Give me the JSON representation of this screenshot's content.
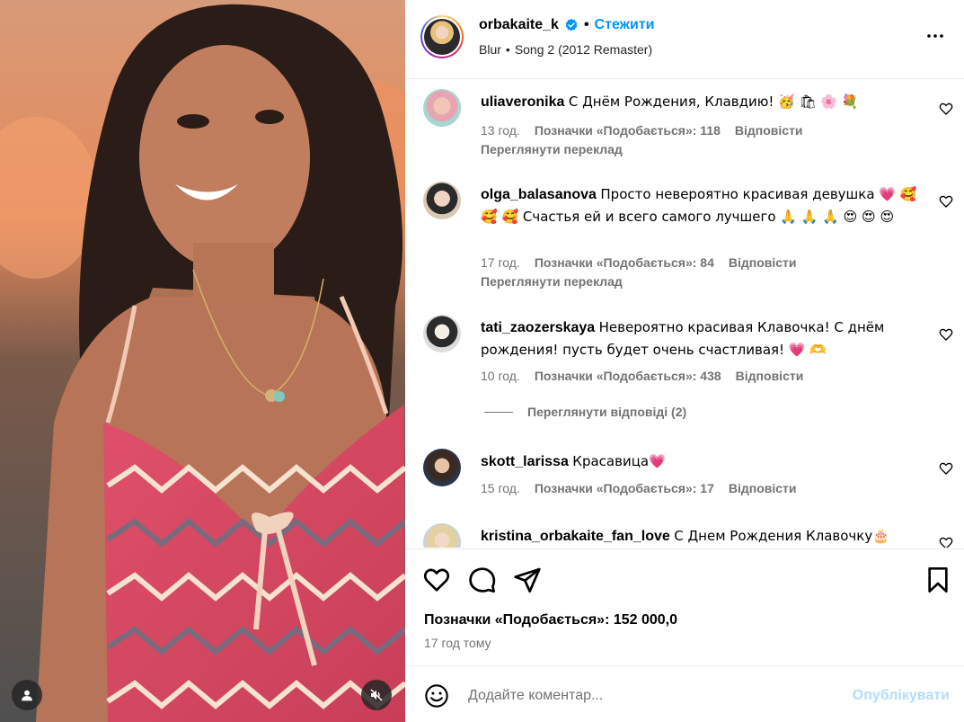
{
  "header": {
    "username": "orbakaite_k",
    "separator": "•",
    "follow_label": "Стежити",
    "audio_artist": "Blur",
    "audio_separator": "•",
    "audio_track": "Song 2 (2012 Remaster)"
  },
  "comments": [
    {
      "username": "uliaveronika",
      "text": "С Днём Рождения, Клавдию! 🥳 🛍 🌸 💐",
      "time": "13 год.",
      "likes": "Позначки «Подобається»: 118",
      "reply": "Відповісти",
      "translate": "Переглянути переклад"
    },
    {
      "username": "olga_balasanova",
      "text": "Просто невероятно красивая девушка 💗 🥰 🥰 🥰 Счастья ей и всего самого лучшего 🙏 🙏 🙏 😍 😍 😍",
      "time": "17 год.",
      "likes": "Позначки «Подобається»: 84",
      "reply": "Відповісти",
      "translate": "Переглянути переклад"
    },
    {
      "username": "tati_zaozerskaya",
      "text": "Невероятно красивая Клавочка! С днём рождения! пусть будет очень счастливая! 💗 🫶",
      "time": "10 год.",
      "likes": "Позначки «Подобається»: 438",
      "reply": "Відповісти"
    },
    {
      "username": "skott_larissa",
      "text": "Красавица💗",
      "time": "15 год.",
      "likes": "Позначки «Подобається»: 17",
      "reply": "Відповісти"
    },
    {
      "username": "kristina_orbakaite_fan_love",
      "text": "С Днем Рождения Клавочку🎂"
    }
  ],
  "view_replies": "Переглянути відповіді (2)",
  "footer": {
    "likes": "Позначки «Подобається»: 152 000,0",
    "time": "17 год тому"
  },
  "composer": {
    "placeholder": "Додайте коментар...",
    "publish_label": "Опублікувати"
  },
  "icons": {
    "verified": "verified-badge-icon",
    "more": "more-options-icon",
    "like": "heart-icon",
    "comment": "comment-icon",
    "share": "send-icon",
    "save": "bookmark-icon",
    "emoji": "emoji-icon",
    "tag": "user-tag-icon",
    "mute": "muted-speaker-icon"
  },
  "colors": {
    "accent": "#0095f6",
    "muted_text": "#737373",
    "publish_disabled": "#b3dbff"
  }
}
